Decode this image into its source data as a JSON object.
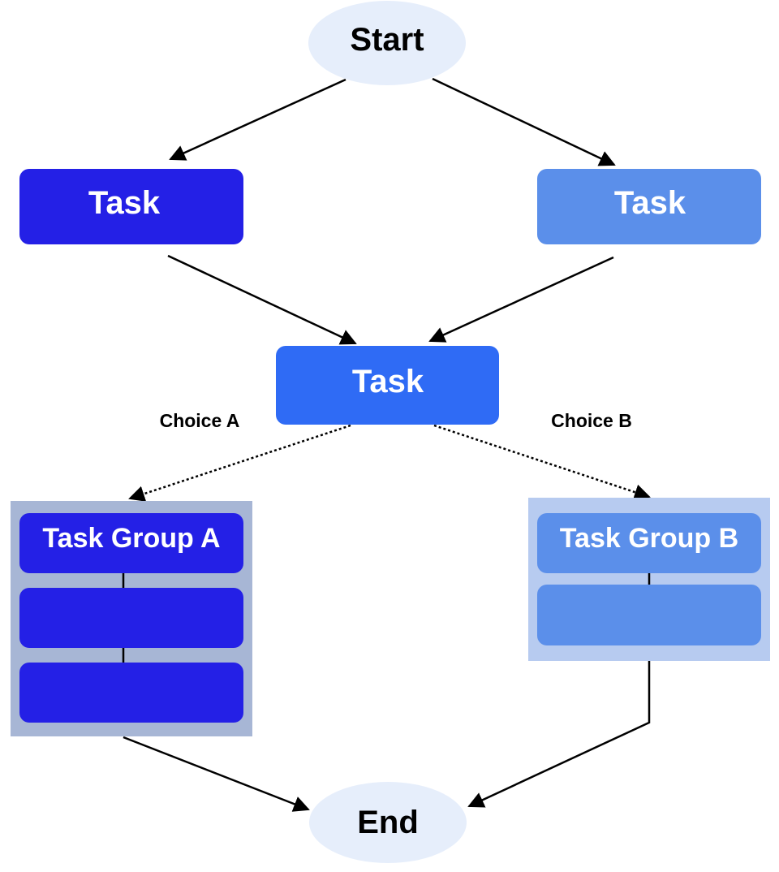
{
  "colors": {
    "terminal_fill": "#E6EEFB",
    "task_dark": "#2420E6",
    "task_light": "#5B8FEA",
    "task_mid": "#2F6BF5",
    "group_a_bg": "#A7B6D5",
    "group_b_bg": "#B7CBF0"
  },
  "nodes": {
    "start": "Start",
    "task_left": "Task",
    "task_right": "Task",
    "task_center": "Task",
    "group_a_title": "Task Group A",
    "group_b_title": "Task Group B",
    "end": "End"
  },
  "edges": {
    "choice_a": "Choice A",
    "choice_b": "Choice B"
  }
}
